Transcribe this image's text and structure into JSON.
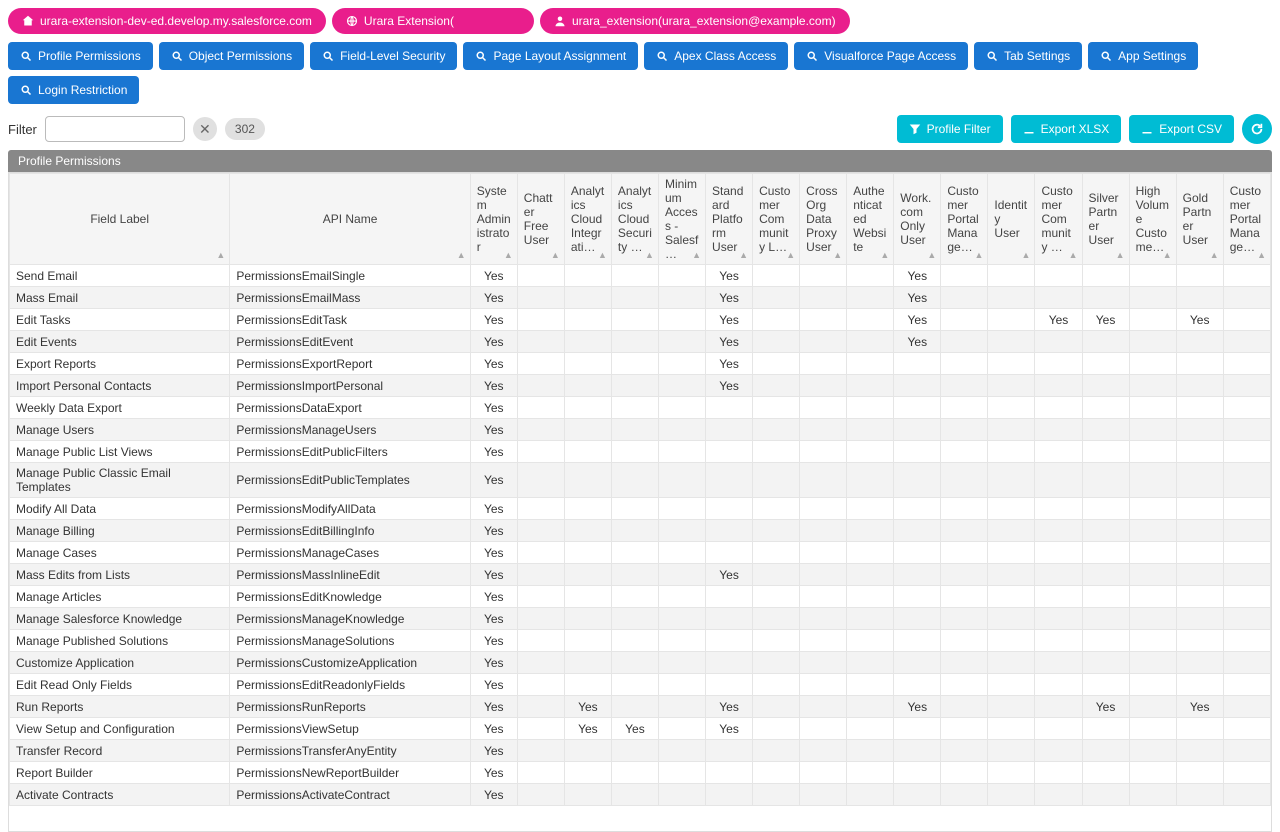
{
  "header": {
    "domain": "urara-extension-dev-ed.develop.my.salesforce.com",
    "extension": "Urara Extension(",
    "user": "urara_extension(urara_extension@example.com)"
  },
  "nav": [
    "Profile Permissions",
    "Object Permissions",
    "Field-Level Security",
    "Page Layout Assignment",
    "Apex Class Access",
    "Visualforce Page Access",
    "Tab Settings",
    "App Settings",
    "Login Restriction"
  ],
  "filter": {
    "label": "Filter",
    "value": "",
    "count": "302"
  },
  "actions": {
    "profileFilter": "Profile Filter",
    "exportXlsx": "Export XLSX",
    "exportCsv": "Export CSV"
  },
  "section": "Profile Permissions",
  "columns": {
    "fieldLabel": "Field Label",
    "apiName": "API Name",
    "profiles": [
      "System Administrator",
      "Chatter Free User",
      "Analytics Cloud Integrati…",
      "Analytics Cloud Security …",
      "Minimum Access - Salesf…",
      "Standard Platform User",
      "Customer Community L…",
      "Cross Org Data Proxy User",
      "Authenticated Website",
      "Work.com Only User",
      "Customer Portal Manage…",
      "Identity User",
      "Customer Community …",
      "Silver Partner User",
      "High Volume Custome…",
      "Gold Partner User",
      "Customer Portal Manage…"
    ]
  },
  "yes": "Yes",
  "rows": [
    {
      "label": "Send Email",
      "api": "PermissionsEmailSingle",
      "v": [
        1,
        0,
        0,
        0,
        0,
        1,
        0,
        0,
        0,
        1,
        0,
        0,
        0,
        0,
        0,
        0,
        0
      ]
    },
    {
      "label": "Mass Email",
      "api": "PermissionsEmailMass",
      "v": [
        1,
        0,
        0,
        0,
        0,
        1,
        0,
        0,
        0,
        1,
        0,
        0,
        0,
        0,
        0,
        0,
        0
      ]
    },
    {
      "label": "Edit Tasks",
      "api": "PermissionsEditTask",
      "v": [
        1,
        0,
        0,
        0,
        0,
        1,
        0,
        0,
        0,
        1,
        0,
        0,
        1,
        1,
        0,
        1,
        0
      ]
    },
    {
      "label": "Edit Events",
      "api": "PermissionsEditEvent",
      "v": [
        1,
        0,
        0,
        0,
        0,
        1,
        0,
        0,
        0,
        1,
        0,
        0,
        0,
        0,
        0,
        0,
        0
      ]
    },
    {
      "label": "Export Reports",
      "api": "PermissionsExportReport",
      "v": [
        1,
        0,
        0,
        0,
        0,
        1,
        0,
        0,
        0,
        0,
        0,
        0,
        0,
        0,
        0,
        0,
        0
      ]
    },
    {
      "label": "Import Personal Contacts",
      "api": "PermissionsImportPersonal",
      "v": [
        1,
        0,
        0,
        0,
        0,
        1,
        0,
        0,
        0,
        0,
        0,
        0,
        0,
        0,
        0,
        0,
        0
      ]
    },
    {
      "label": "Weekly Data Export",
      "api": "PermissionsDataExport",
      "v": [
        1,
        0,
        0,
        0,
        0,
        0,
        0,
        0,
        0,
        0,
        0,
        0,
        0,
        0,
        0,
        0,
        0
      ]
    },
    {
      "label": "Manage Users",
      "api": "PermissionsManageUsers",
      "v": [
        1,
        0,
        0,
        0,
        0,
        0,
        0,
        0,
        0,
        0,
        0,
        0,
        0,
        0,
        0,
        0,
        0
      ]
    },
    {
      "label": "Manage Public List Views",
      "api": "PermissionsEditPublicFilters",
      "v": [
        1,
        0,
        0,
        0,
        0,
        0,
        0,
        0,
        0,
        0,
        0,
        0,
        0,
        0,
        0,
        0,
        0
      ]
    },
    {
      "label": "Manage Public Classic Email Templates",
      "api": "PermissionsEditPublicTemplates",
      "v": [
        1,
        0,
        0,
        0,
        0,
        0,
        0,
        0,
        0,
        0,
        0,
        0,
        0,
        0,
        0,
        0,
        0
      ]
    },
    {
      "label": "Modify All Data",
      "api": "PermissionsModifyAllData",
      "v": [
        1,
        0,
        0,
        0,
        0,
        0,
        0,
        0,
        0,
        0,
        0,
        0,
        0,
        0,
        0,
        0,
        0
      ]
    },
    {
      "label": "Manage Billing",
      "api": "PermissionsEditBillingInfo",
      "v": [
        1,
        0,
        0,
        0,
        0,
        0,
        0,
        0,
        0,
        0,
        0,
        0,
        0,
        0,
        0,
        0,
        0
      ]
    },
    {
      "label": "Manage Cases",
      "api": "PermissionsManageCases",
      "v": [
        1,
        0,
        0,
        0,
        0,
        0,
        0,
        0,
        0,
        0,
        0,
        0,
        0,
        0,
        0,
        0,
        0
      ]
    },
    {
      "label": "Mass Edits from Lists",
      "api": "PermissionsMassInlineEdit",
      "v": [
        1,
        0,
        0,
        0,
        0,
        1,
        0,
        0,
        0,
        0,
        0,
        0,
        0,
        0,
        0,
        0,
        0
      ]
    },
    {
      "label": "Manage Articles",
      "api": "PermissionsEditKnowledge",
      "v": [
        1,
        0,
        0,
        0,
        0,
        0,
        0,
        0,
        0,
        0,
        0,
        0,
        0,
        0,
        0,
        0,
        0
      ]
    },
    {
      "label": "Manage Salesforce Knowledge",
      "api": "PermissionsManageKnowledge",
      "v": [
        1,
        0,
        0,
        0,
        0,
        0,
        0,
        0,
        0,
        0,
        0,
        0,
        0,
        0,
        0,
        0,
        0
      ]
    },
    {
      "label": "Manage Published Solutions",
      "api": "PermissionsManageSolutions",
      "v": [
        1,
        0,
        0,
        0,
        0,
        0,
        0,
        0,
        0,
        0,
        0,
        0,
        0,
        0,
        0,
        0,
        0
      ]
    },
    {
      "label": "Customize Application",
      "api": "PermissionsCustomizeApplication",
      "v": [
        1,
        0,
        0,
        0,
        0,
        0,
        0,
        0,
        0,
        0,
        0,
        0,
        0,
        0,
        0,
        0,
        0
      ]
    },
    {
      "label": "Edit Read Only Fields",
      "api": "PermissionsEditReadonlyFields",
      "v": [
        1,
        0,
        0,
        0,
        0,
        0,
        0,
        0,
        0,
        0,
        0,
        0,
        0,
        0,
        0,
        0,
        0
      ]
    },
    {
      "label": "Run Reports",
      "api": "PermissionsRunReports",
      "v": [
        1,
        0,
        1,
        0,
        0,
        1,
        0,
        0,
        0,
        1,
        0,
        0,
        0,
        1,
        0,
        1,
        0
      ]
    },
    {
      "label": "View Setup and Configuration",
      "api": "PermissionsViewSetup",
      "v": [
        1,
        0,
        1,
        1,
        0,
        1,
        0,
        0,
        0,
        0,
        0,
        0,
        0,
        0,
        0,
        0,
        0
      ]
    },
    {
      "label": "Transfer Record",
      "api": "PermissionsTransferAnyEntity",
      "v": [
        1,
        0,
        0,
        0,
        0,
        0,
        0,
        0,
        0,
        0,
        0,
        0,
        0,
        0,
        0,
        0,
        0
      ]
    },
    {
      "label": "Report Builder",
      "api": "PermissionsNewReportBuilder",
      "v": [
        1,
        0,
        0,
        0,
        0,
        0,
        0,
        0,
        0,
        0,
        0,
        0,
        0,
        0,
        0,
        0,
        0
      ]
    },
    {
      "label": "Activate Contracts",
      "api": "PermissionsActivateContract",
      "v": [
        1,
        0,
        0,
        0,
        0,
        0,
        0,
        0,
        0,
        0,
        0,
        0,
        0,
        0,
        0,
        0,
        0
      ]
    }
  ]
}
